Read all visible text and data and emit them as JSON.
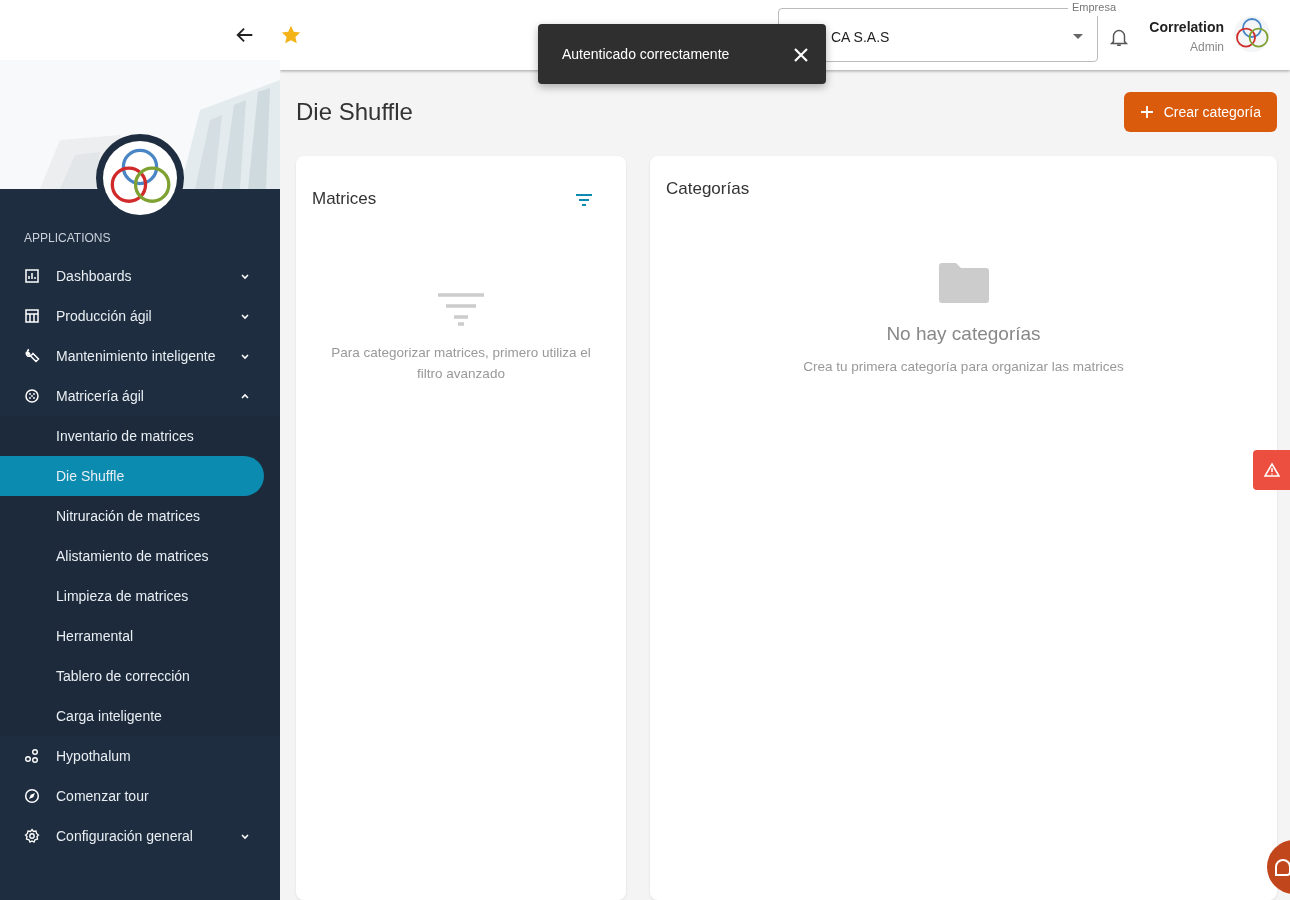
{
  "sidebar": {
    "section_label": "APPLICATIONS",
    "items": [
      {
        "kind": "group",
        "label": "Dashboards",
        "expanded": false
      },
      {
        "kind": "group",
        "label": "Producción ágil",
        "expanded": false
      },
      {
        "kind": "group",
        "label": "Mantenimiento inteligente",
        "expanded": false
      },
      {
        "kind": "group",
        "label": "Matricería ágil",
        "expanded": true,
        "children": [
          {
            "label": "Inventario de matrices",
            "selected": false
          },
          {
            "label": "Die Shuffle",
            "selected": true
          },
          {
            "label": "Nitruración de matrices",
            "selected": false
          },
          {
            "label": "Alistamiento de matrices",
            "selected": false
          },
          {
            "label": "Limpieza de matrices",
            "selected": false
          },
          {
            "label": "Herramental",
            "selected": false
          },
          {
            "label": "Tablero de corrección",
            "selected": false
          },
          {
            "label": "Carga inteligente",
            "selected": false
          }
        ]
      },
      {
        "kind": "link",
        "label": "Hypothalum"
      },
      {
        "kind": "link",
        "label": "Comenzar tour"
      },
      {
        "kind": "group",
        "label": "Configuración general",
        "expanded": false
      }
    ]
  },
  "header": {
    "company_field": {
      "label": "Empresa",
      "value": "CA S.A.S"
    },
    "user_name": "Correlation",
    "user_role": "Admin"
  },
  "toast": {
    "message": "Autenticado correctamente"
  },
  "page": {
    "title": "Die Shuffle",
    "create_button": "Crear categoría"
  },
  "matrices_card": {
    "title": "Matrices",
    "empty_text": "Para categorizar matrices, primero utiliza el filtro avanzado"
  },
  "categories_card": {
    "title": "Categorías",
    "empty_title": "No hay categorías",
    "empty_text": "Crea tu primera categoría para organizar las matrices"
  }
}
